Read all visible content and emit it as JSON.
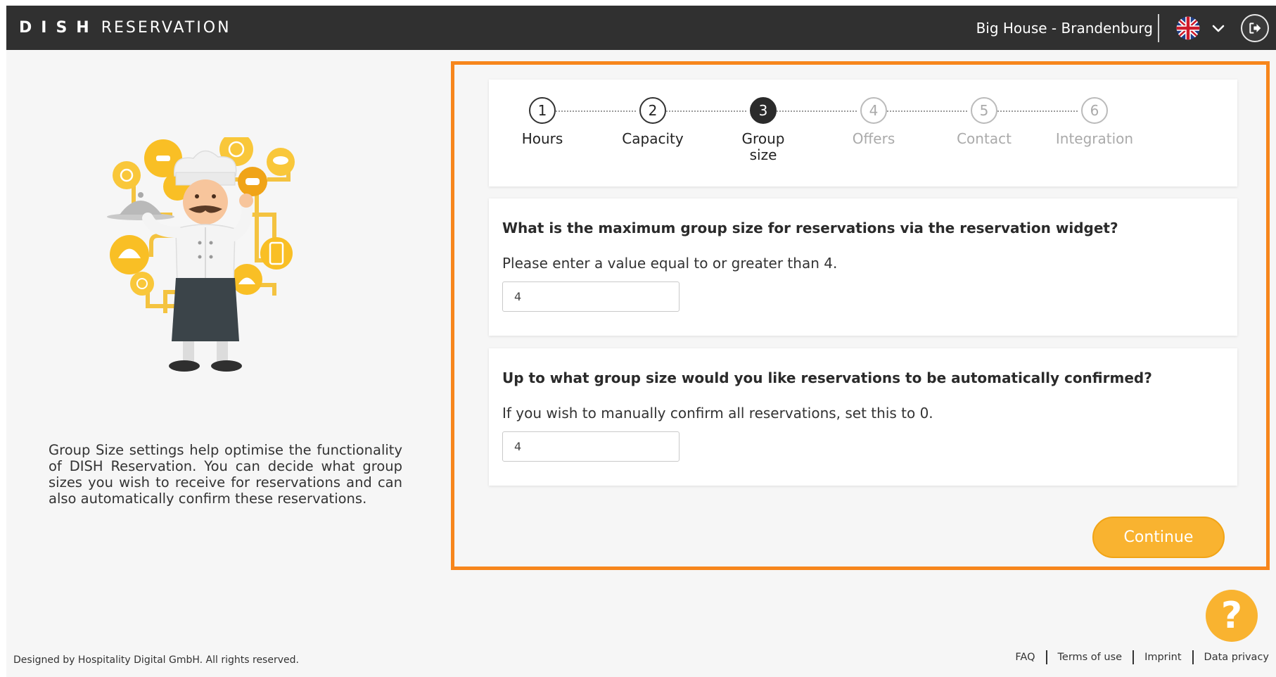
{
  "header": {
    "brand": "DISH",
    "product": "RESERVATION",
    "venue": "Big House - Brandenburg",
    "language_icon": "uk-flag-icon",
    "language_dropdown_icon": "chevron-down-icon",
    "logout_icon": "logout-icon"
  },
  "left_panel": {
    "illustration": "chef-illustration",
    "description": "Group Size settings help optimise the functionality of DISH Reservation. You can decide what group sizes you wish to receive for reservations and can also automatically confirm these reservations."
  },
  "stepper": {
    "steps": [
      {
        "number": "1",
        "label": "Hours",
        "state": "done"
      },
      {
        "number": "2",
        "label": "Capacity",
        "state": "done"
      },
      {
        "number": "3",
        "label": "Group size",
        "state": "active"
      },
      {
        "number": "4",
        "label": "Offers",
        "state": "pending"
      },
      {
        "number": "5",
        "label": "Contact",
        "state": "pending"
      },
      {
        "number": "6",
        "label": "Integration",
        "state": "pending"
      }
    ]
  },
  "questions": {
    "max_group": {
      "title": "What is the maximum group size for reservations via the reservation widget?",
      "hint": "Please enter a value equal to or greater than 4.",
      "value": "4"
    },
    "auto_confirm": {
      "title": "Up to what group size would you like reservations to be automatically confirmed?",
      "hint": "If you wish to manually confirm all reservations, set this to 0.",
      "value": "4"
    }
  },
  "actions": {
    "continue_label": "Continue",
    "help_label": "?"
  },
  "footer": {
    "copyright": "Designed by Hospitality Digital GmbH. All rights reserved.",
    "links": [
      "FAQ",
      "Terms of use",
      "Imprint",
      "Data privacy"
    ]
  },
  "colors": {
    "header_bg": "#303030",
    "accent": "#f9b330",
    "highlight": "#f7861c"
  }
}
